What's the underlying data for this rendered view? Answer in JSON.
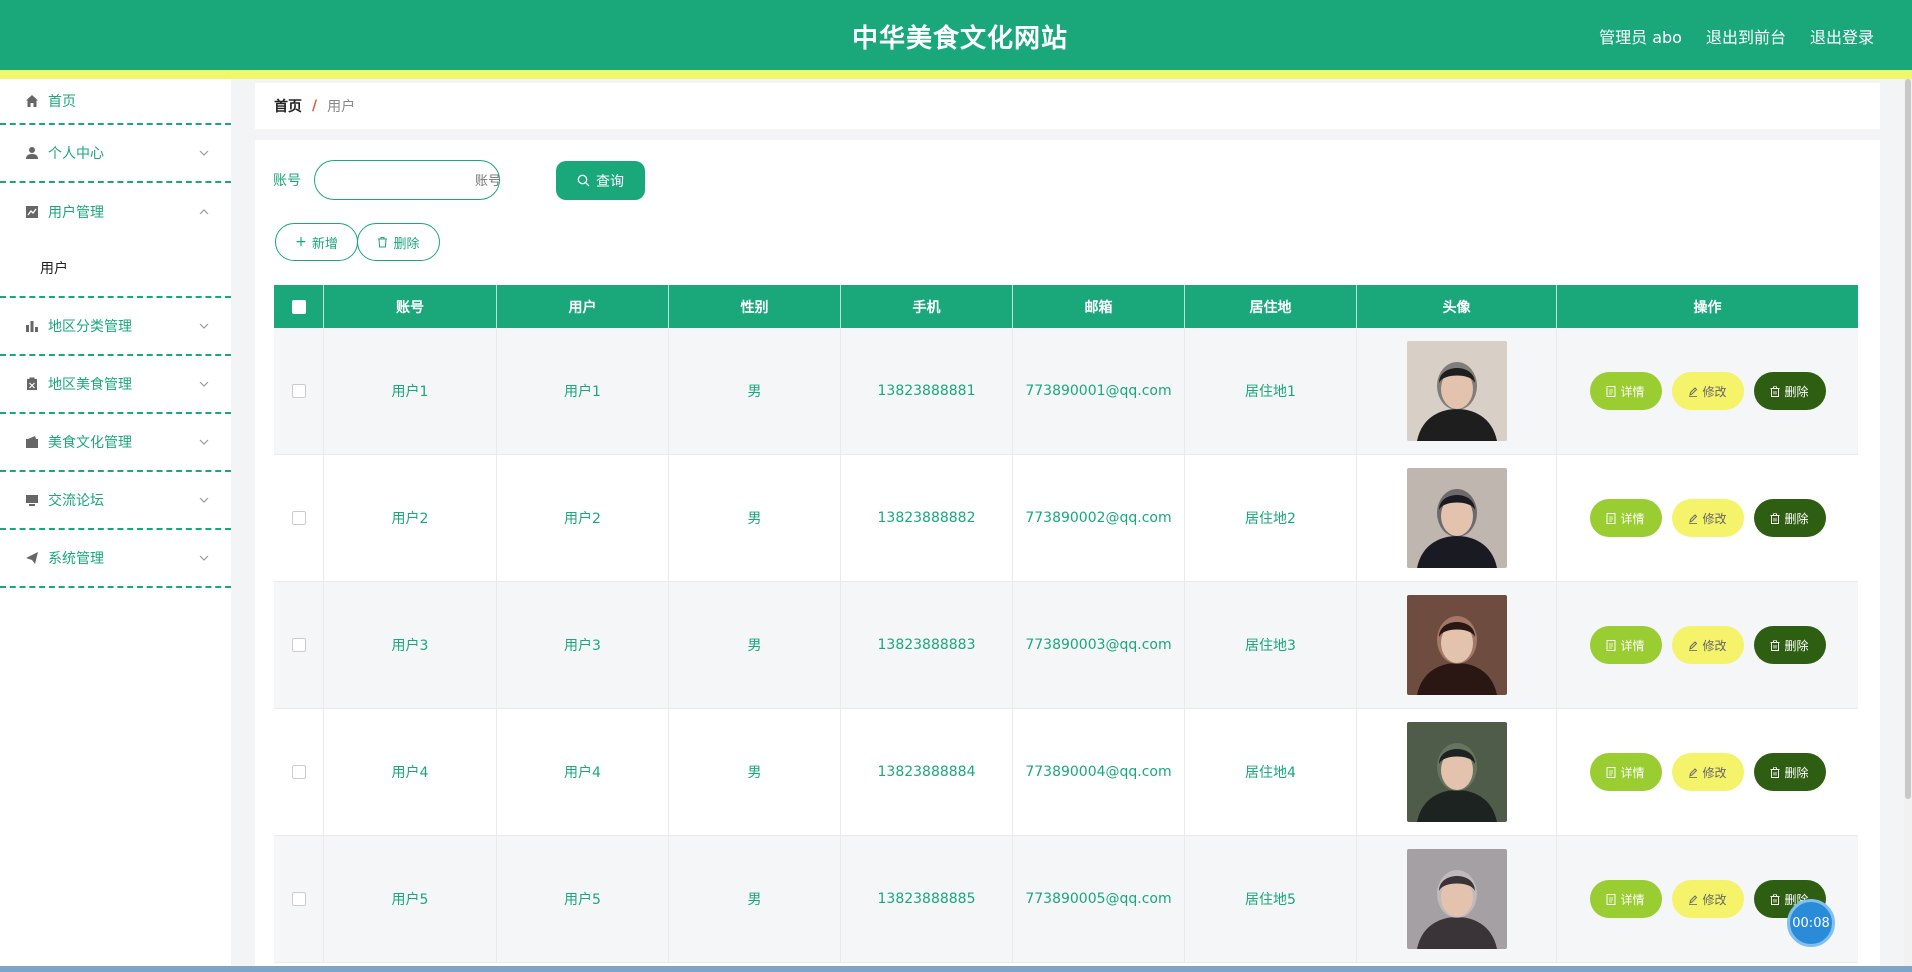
{
  "header": {
    "title": "中华美食文化网站",
    "admin_label": "管理员 abo",
    "to_front": "退出到前台",
    "logout": "退出登录"
  },
  "sidebar": {
    "items": [
      {
        "label": "首页",
        "icon": "home-icon"
      },
      {
        "label": "个人中心",
        "icon": "user-icon"
      },
      {
        "label": "用户管理",
        "icon": "chart-icon"
      },
      {
        "label": "地区分类管理",
        "icon": "bar-chart-icon"
      },
      {
        "label": "地区美食管理",
        "icon": "clipboard-icon"
      },
      {
        "label": "美食文化管理",
        "icon": "wallet-icon"
      },
      {
        "label": "交流论坛",
        "icon": "monitor-icon"
      },
      {
        "label": "系统管理",
        "icon": "send-icon"
      }
    ],
    "submenu_user": "用户"
  },
  "breadcrumb": {
    "home": "首页",
    "separator": "/",
    "current": "用户"
  },
  "search": {
    "label": "账号",
    "placeholder": "账号",
    "button": "查询"
  },
  "actions": {
    "add": "新增",
    "delete": "删除"
  },
  "table": {
    "headers": [
      "账号",
      "用户",
      "性别",
      "手机",
      "邮箱",
      "居住地",
      "头像",
      "操作"
    ],
    "rows": [
      {
        "account": "用户1",
        "user": "用户1",
        "gender": "男",
        "phone": "13823888881",
        "email": "773890001@qq.com",
        "residence": "居住地1"
      },
      {
        "account": "用户2",
        "user": "用户2",
        "gender": "男",
        "phone": "13823888882",
        "email": "773890002@qq.com",
        "residence": "居住地2"
      },
      {
        "account": "用户3",
        "user": "用户3",
        "gender": "男",
        "phone": "13823888883",
        "email": "773890003@qq.com",
        "residence": "居住地3"
      },
      {
        "account": "用户4",
        "user": "用户4",
        "gender": "男",
        "phone": "13823888884",
        "email": "773890004@qq.com",
        "residence": "居住地4"
      },
      {
        "account": "用户5",
        "user": "用户5",
        "gender": "男",
        "phone": "13823888885",
        "email": "773890005@qq.com",
        "residence": "居住地5"
      }
    ],
    "op_detail": "详情",
    "op_edit": "修改",
    "op_delete": "删除"
  },
  "timer": "00:08",
  "colors": {
    "primary": "#1aa87a",
    "stripe": "#f1f76a",
    "detail": "#9acd32",
    "edit": "#f4f36a",
    "delete": "#2e5e12"
  }
}
